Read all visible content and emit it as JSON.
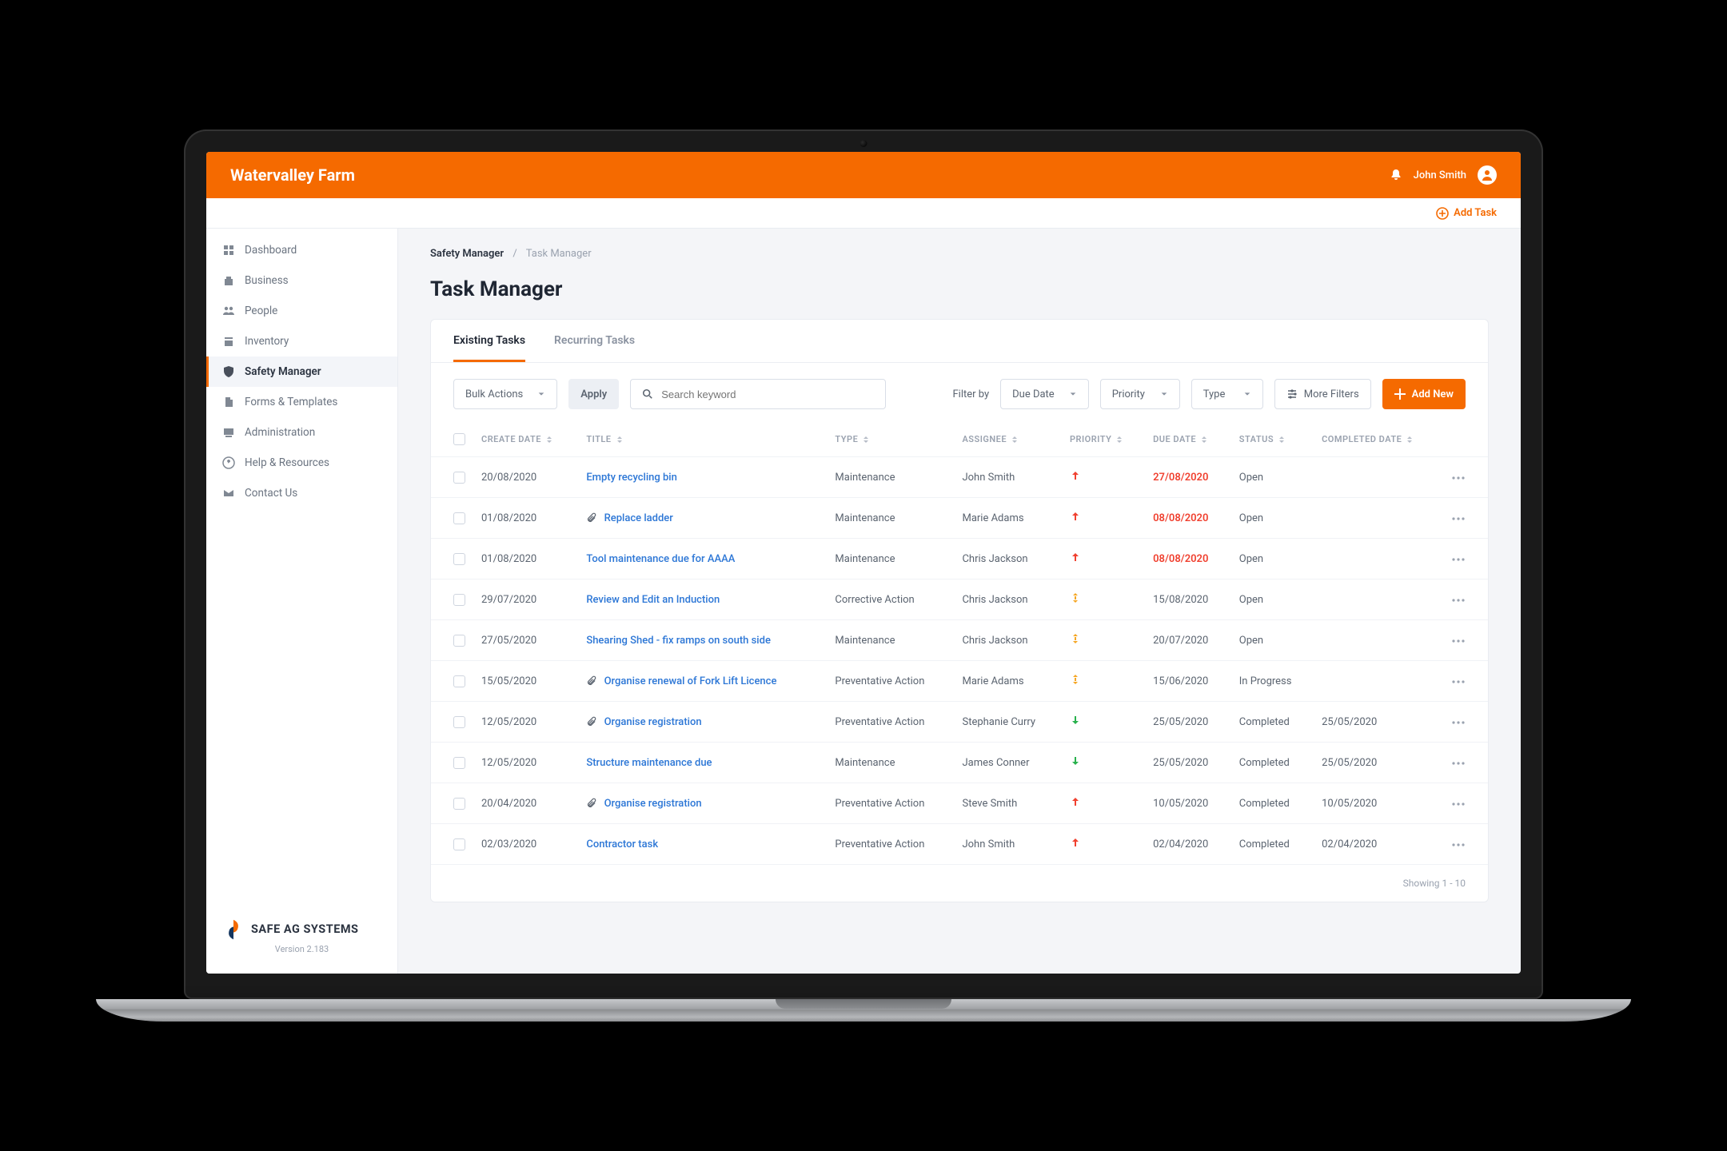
{
  "header": {
    "title": "Watervalley Farm",
    "user": "John Smith"
  },
  "subheader": {
    "add_task": "Add Task"
  },
  "sidebar": {
    "items": [
      {
        "label": "Dashboard",
        "icon": "dashboard"
      },
      {
        "label": "Business",
        "icon": "business"
      },
      {
        "label": "People",
        "icon": "people"
      },
      {
        "label": "Inventory",
        "icon": "inventory"
      },
      {
        "label": "Safety Manager",
        "icon": "shield",
        "active": true
      },
      {
        "label": "Forms & Templates",
        "icon": "forms"
      },
      {
        "label": "Administration",
        "icon": "admin"
      },
      {
        "label": "Help & Resources",
        "icon": "help"
      },
      {
        "label": "Contact Us",
        "icon": "contact"
      }
    ],
    "brand": "SAFE AG SYSTEMS",
    "version": "Version 2.183"
  },
  "breadcrumbs": {
    "root": "Safety Manager",
    "current": "Task Manager"
  },
  "page_title": "Task Manager",
  "tabs": {
    "existing": "Existing Tasks",
    "recurring": "Recurring Tasks"
  },
  "toolbar": {
    "bulk_actions": "Bulk Actions",
    "apply": "Apply",
    "search_placeholder": "Search keyword",
    "filter_by": "Filter by",
    "due_date": "Due Date",
    "priority": "Priority",
    "type": "Type",
    "more_filters": "More Filters",
    "add_new": "Add New"
  },
  "columns": {
    "create_date": "Create Date",
    "title": "Title",
    "type": "Type",
    "assignee": "Assignee",
    "priority": "Priority",
    "due_date": "Due Date",
    "status": "Status",
    "completed_date": "Completed Date"
  },
  "rows": [
    {
      "create_date": "20/08/2020",
      "title": "Empty recycling bin",
      "attach": false,
      "type": "Maintenance",
      "assignee": "John Smith",
      "priority": "high",
      "due_date": "27/08/2020",
      "due_overdue": true,
      "status": "Open",
      "completed_date": ""
    },
    {
      "create_date": "01/08/2020",
      "title": "Replace ladder",
      "attach": true,
      "type": "Maintenance",
      "assignee": "Marie Adams",
      "priority": "high",
      "due_date": "08/08/2020",
      "due_overdue": true,
      "status": "Open",
      "completed_date": ""
    },
    {
      "create_date": "01/08/2020",
      "title": "Tool maintenance due for AAAA",
      "attach": false,
      "type": "Maintenance",
      "assignee": "Chris Jackson",
      "priority": "high",
      "due_date": "08/08/2020",
      "due_overdue": true,
      "status": "Open",
      "completed_date": ""
    },
    {
      "create_date": "29/07/2020",
      "title": "Review and Edit an Induction",
      "attach": false,
      "type": "Corrective Action",
      "assignee": "Chris Jackson",
      "priority": "med",
      "due_date": "15/08/2020",
      "due_overdue": false,
      "status": "Open",
      "completed_date": ""
    },
    {
      "create_date": "27/05/2020",
      "title": "Shearing Shed - fix ramps on south side",
      "attach": false,
      "type": "Maintenance",
      "assignee": "Chris Jackson",
      "priority": "med",
      "due_date": "20/07/2020",
      "due_overdue": false,
      "status": "Open",
      "completed_date": ""
    },
    {
      "create_date": "15/05/2020",
      "title": "Organise renewal of Fork Lift Licence",
      "attach": true,
      "type": "Preventative Action",
      "assignee": "Marie Adams",
      "priority": "med",
      "due_date": "15/06/2020",
      "due_overdue": false,
      "status": "In Progress",
      "completed_date": ""
    },
    {
      "create_date": "12/05/2020",
      "title": "Organise registration",
      "attach": true,
      "type": "Preventative Action",
      "assignee": "Stephanie Curry",
      "priority": "low",
      "due_date": "25/05/2020",
      "due_overdue": false,
      "status": "Completed",
      "completed_date": "25/05/2020"
    },
    {
      "create_date": "12/05/2020",
      "title": "Structure maintenance due",
      "attach": false,
      "type": "Maintenance",
      "assignee": "James Conner",
      "priority": "low",
      "due_date": "25/05/2020",
      "due_overdue": false,
      "status": "Completed",
      "completed_date": "25/05/2020"
    },
    {
      "create_date": "20/04/2020",
      "title": "Organise registration",
      "attach": true,
      "type": "Preventative Action",
      "assignee": "Steve Smith",
      "priority": "high",
      "due_date": "10/05/2020",
      "due_overdue": false,
      "status": "Completed",
      "completed_date": "10/05/2020"
    },
    {
      "create_date": "02/03/2020",
      "title": "Contractor task",
      "attach": false,
      "type": "Preventative Action",
      "assignee": "John Smith",
      "priority": "high",
      "due_date": "02/04/2020",
      "due_overdue": false,
      "status": "Completed",
      "completed_date": "02/04/2020"
    }
  ],
  "footer": "Showing 1 - 10"
}
